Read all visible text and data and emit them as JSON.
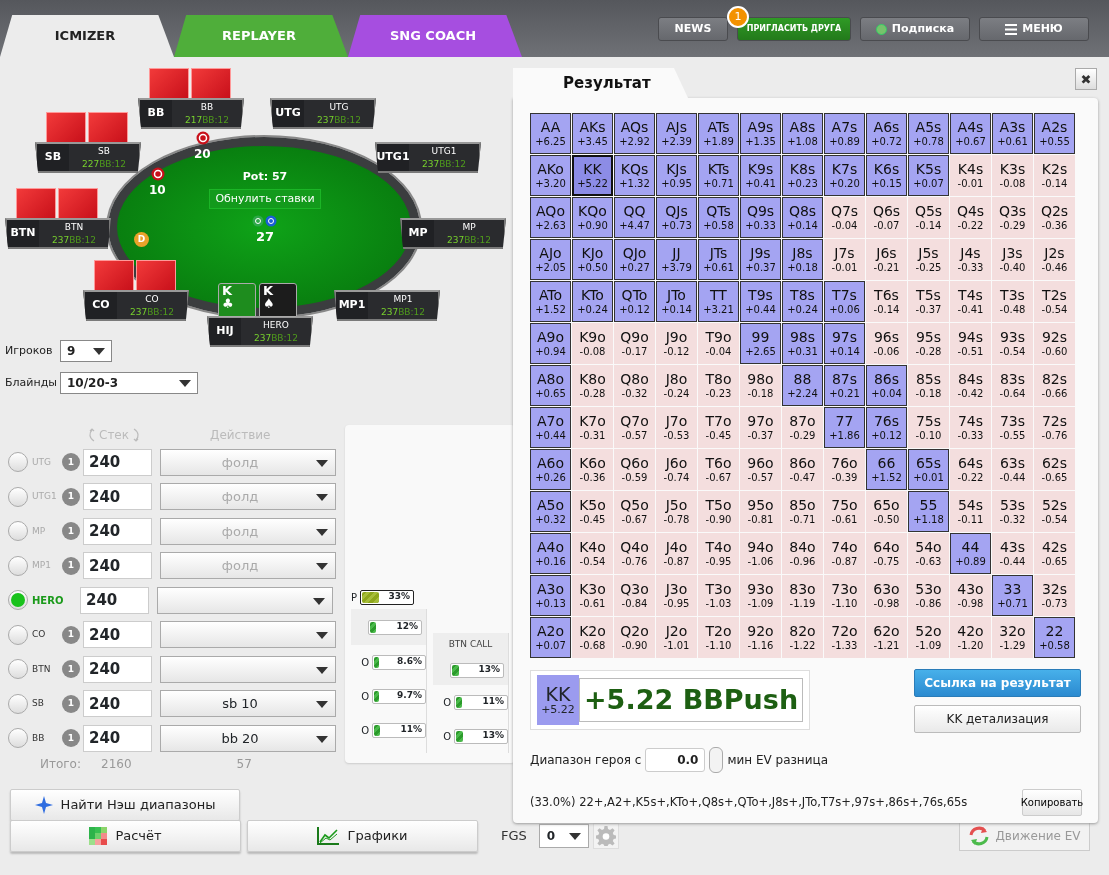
{
  "header": {
    "tabs": [
      {
        "label": "ICMIZER",
        "selected": true,
        "color": "#ececec"
      },
      {
        "label": "REPLAYER",
        "selected": false,
        "color": "#4fae3a"
      },
      {
        "label": "SNG COACH",
        "selected": false,
        "color": "#a64ee0"
      }
    ],
    "buttons": [
      {
        "kind": "plain",
        "label": "NEWS"
      },
      {
        "kind": "invite",
        "label": "ПРИГЛАСИТЬ ДРУГА",
        "badge": "1"
      },
      {
        "kind": "status",
        "label": "Подписка"
      },
      {
        "kind": "menu",
        "label": "МЕНЮ"
      }
    ]
  },
  "table": {
    "pot": "Pot: 57",
    "reset_button": "Обнулить ставки",
    "center_chips": "27",
    "dealer_button": "D",
    "seats": [
      {
        "position": "BB",
        "name": "BB",
        "stack": "217",
        "bb": "BB:12",
        "has_cards": true
      },
      {
        "position": "UTG",
        "name": "UTG",
        "stack": "237",
        "bb": "BB:12",
        "has_cards": false
      },
      {
        "position": "SB",
        "name": "SB",
        "stack": "227",
        "bb": "BB:12",
        "has_cards": true
      },
      {
        "position": "UTG1",
        "name": "UTG1",
        "stack": "237",
        "bb": "BB:12",
        "has_cards": false
      },
      {
        "position": "BTN",
        "name": "BTN",
        "stack": "237",
        "bb": "BB:12",
        "has_cards": true
      },
      {
        "position": "MP",
        "name": "MP",
        "stack": "237",
        "bb": "BB:12",
        "has_cards": false
      },
      {
        "position": "CO",
        "name": "CO",
        "stack": "237",
        "bb": "BB:12",
        "has_cards": true
      },
      {
        "position": "MP1",
        "name": "MP1",
        "stack": "237",
        "bb": "BB:12",
        "has_cards": false
      },
      {
        "position": "HIJ",
        "name": "HERO",
        "stack": "237",
        "bb": "BB:12",
        "has_cards": false
      }
    ],
    "hero_cards": [
      {
        "rank": "K",
        "suit": "♣",
        "color": "#1e8c1e"
      },
      {
        "rank": "K",
        "suit": "♠",
        "color": "#1c1c1c"
      }
    ],
    "bets": [
      {
        "amount": "20"
      },
      {
        "amount": "10"
      }
    ]
  },
  "settings": {
    "players": {
      "label": "Игроков",
      "value": "9"
    },
    "blinds": {
      "label": "Блайнды",
      "value": "10/20-3"
    }
  },
  "players_table": {
    "stack_header": "Стек",
    "action_header": "Действие",
    "rows": [
      {
        "position": "UTG",
        "selected": false,
        "folded": true,
        "count": "1",
        "stack": "240",
        "action": "фолд"
      },
      {
        "position": "UTG1",
        "selected": false,
        "folded": true,
        "count": "1",
        "stack": "240",
        "action": "фолд"
      },
      {
        "position": "MP",
        "selected": false,
        "folded": true,
        "count": "1",
        "stack": "240",
        "action": "фолд"
      },
      {
        "position": "MP1",
        "selected": false,
        "folded": true,
        "count": "1",
        "stack": "240",
        "action": "фолд"
      },
      {
        "position": "HERO",
        "selected": true,
        "folded": false,
        "stack": "240"
      },
      {
        "position": "CO",
        "selected": false,
        "folded": false,
        "count": "1",
        "stack": "240"
      },
      {
        "position": "BTN",
        "selected": false,
        "folded": false,
        "count": "1",
        "stack": "240"
      },
      {
        "position": "SB",
        "selected": false,
        "folded": false,
        "count": "1",
        "stack": "240",
        "action": "sb 10"
      },
      {
        "position": "BB",
        "selected": false,
        "folded": false,
        "count": "1",
        "stack": "240",
        "action": "bb 20"
      }
    ],
    "total_label": "Итого:",
    "total_stack": "2160",
    "total_pot": "57"
  },
  "ranges_panel": {
    "push": {
      "label": "P",
      "reading": "33%",
      "level": 0.33
    },
    "columns": [
      {
        "bars": [
          {
            "reading": "12%",
            "level": 0.12
          },
          {
            "label": "O",
            "reading": "8.6%",
            "level": 0.086
          },
          {
            "label": "O",
            "reading": "9.7%",
            "level": 0.097
          },
          {
            "label": "O",
            "reading": "11%",
            "level": 0.11
          }
        ]
      },
      {
        "header": "BTN CALL",
        "bars": [
          {
            "reading": "13%",
            "level": 0.13
          },
          {
            "label": "O",
            "reading": "11%",
            "level": 0.11
          },
          {
            "label": "O",
            "reading": "13%",
            "level": 0.13
          }
        ]
      }
    ]
  },
  "bottom": {
    "nash_button": "Найти Нэш диапазоны",
    "calc_button": "Расчёт",
    "charts_button": "Графики",
    "fgs_label": "FGS",
    "fgs_value": "0",
    "ev_button": {
      "label": "Движение EV",
      "disabled": true
    }
  },
  "result": {
    "tab": "Результат",
    "close": "✖",
    "matrix": [
      [
        {
          "hand": "AA",
          "ev": "+6.25",
          "in_range": true,
          "selected": false
        },
        {
          "hand": "AKs",
          "ev": "+3.45",
          "in_range": true,
          "selected": false
        },
        {
          "hand": "AQs",
          "ev": "+2.92",
          "in_range": true,
          "selected": false
        },
        {
          "hand": "AJs",
          "ev": "+2.39",
          "in_range": true,
          "selected": false
        },
        {
          "hand": "ATs",
          "ev": "+1.89",
          "in_range": true,
          "selected": false
        },
        {
          "hand": "A9s",
          "ev": "+1.35",
          "in_range": true,
          "selected": false
        },
        {
          "hand": "A8s",
          "ev": "+1.08",
          "in_range": true,
          "selected": false
        },
        {
          "hand": "A7s",
          "ev": "+0.89",
          "in_range": true,
          "selected": false
        },
        {
          "hand": "A6s",
          "ev": "+0.72",
          "in_range": true,
          "selected": false
        },
        {
          "hand": "A5s",
          "ev": "+0.78",
          "in_range": true,
          "selected": false
        },
        {
          "hand": "A4s",
          "ev": "+0.67",
          "in_range": true,
          "selected": false
        },
        {
          "hand": "A3s",
          "ev": "+0.61",
          "in_range": true,
          "selected": false
        },
        {
          "hand": "A2s",
          "ev": "+0.55",
          "in_range": true,
          "selected": false
        }
      ],
      [
        {
          "hand": "AKo",
          "ev": "+3.20",
          "in_range": true,
          "selected": false
        },
        {
          "hand": "KK",
          "ev": "+5.22",
          "in_range": true,
          "selected": true
        },
        {
          "hand": "KQs",
          "ev": "+1.32",
          "in_range": true,
          "selected": false
        },
        {
          "hand": "KJs",
          "ev": "+0.95",
          "in_range": true,
          "selected": false
        },
        {
          "hand": "KTs",
          "ev": "+0.71",
          "in_range": true,
          "selected": false
        },
        {
          "hand": "K9s",
          "ev": "+0.41",
          "in_range": true,
          "selected": false
        },
        {
          "hand": "K8s",
          "ev": "+0.23",
          "in_range": true,
          "selected": false
        },
        {
          "hand": "K7s",
          "ev": "+0.20",
          "in_range": true,
          "selected": false
        },
        {
          "hand": "K6s",
          "ev": "+0.15",
          "in_range": true,
          "selected": false
        },
        {
          "hand": "K5s",
          "ev": "+0.07",
          "in_range": true,
          "selected": false
        },
        {
          "hand": "K4s",
          "ev": "-0.01",
          "in_range": false,
          "selected": false
        },
        {
          "hand": "K3s",
          "ev": "-0.08",
          "in_range": false,
          "selected": false
        },
        {
          "hand": "K2s",
          "ev": "-0.14",
          "in_range": false,
          "selected": false
        }
      ],
      [
        {
          "hand": "AQo",
          "ev": "+2.63",
          "in_range": true,
          "selected": false
        },
        {
          "hand": "KQo",
          "ev": "+0.90",
          "in_range": true,
          "selected": false
        },
        {
          "hand": "QQ",
          "ev": "+4.47",
          "in_range": true,
          "selected": false
        },
        {
          "hand": "QJs",
          "ev": "+0.73",
          "in_range": true,
          "selected": false
        },
        {
          "hand": "QTs",
          "ev": "+0.58",
          "in_range": true,
          "selected": false
        },
        {
          "hand": "Q9s",
          "ev": "+0.33",
          "in_range": true,
          "selected": false
        },
        {
          "hand": "Q8s",
          "ev": "+0.14",
          "in_range": true,
          "selected": false
        },
        {
          "hand": "Q7s",
          "ev": "-0.04",
          "in_range": false,
          "selected": false
        },
        {
          "hand": "Q6s",
          "ev": "-0.07",
          "in_range": false,
          "selected": false
        },
        {
          "hand": "Q5s",
          "ev": "-0.14",
          "in_range": false,
          "selected": false
        },
        {
          "hand": "Q4s",
          "ev": "-0.22",
          "in_range": false,
          "selected": false
        },
        {
          "hand": "Q3s",
          "ev": "-0.29",
          "in_range": false,
          "selected": false
        },
        {
          "hand": "Q2s",
          "ev": "-0.36",
          "in_range": false,
          "selected": false
        }
      ],
      [
        {
          "hand": "AJo",
          "ev": "+2.05",
          "in_range": true,
          "selected": false
        },
        {
          "hand": "KJo",
          "ev": "+0.50",
          "in_range": true,
          "selected": false
        },
        {
          "hand": "QJo",
          "ev": "+0.27",
          "in_range": true,
          "selected": false
        },
        {
          "hand": "JJ",
          "ev": "+3.79",
          "in_range": true,
          "selected": false
        },
        {
          "hand": "JTs",
          "ev": "+0.61",
          "in_range": true,
          "selected": false
        },
        {
          "hand": "J9s",
          "ev": "+0.37",
          "in_range": true,
          "selected": false
        },
        {
          "hand": "J8s",
          "ev": "+0.18",
          "in_range": true,
          "selected": false
        },
        {
          "hand": "J7s",
          "ev": "-0.01",
          "in_range": false,
          "selected": false
        },
        {
          "hand": "J6s",
          "ev": "-0.21",
          "in_range": false,
          "selected": false
        },
        {
          "hand": "J5s",
          "ev": "-0.25",
          "in_range": false,
          "selected": false
        },
        {
          "hand": "J4s",
          "ev": "-0.33",
          "in_range": false,
          "selected": false
        },
        {
          "hand": "J3s",
          "ev": "-0.40",
          "in_range": false,
          "selected": false
        },
        {
          "hand": "J2s",
          "ev": "-0.46",
          "in_range": false,
          "selected": false
        }
      ],
      [
        {
          "hand": "ATo",
          "ev": "+1.52",
          "in_range": true,
          "selected": false
        },
        {
          "hand": "KTo",
          "ev": "+0.24",
          "in_range": true,
          "selected": false
        },
        {
          "hand": "QTo",
          "ev": "+0.12",
          "in_range": true,
          "selected": false
        },
        {
          "hand": "JTo",
          "ev": "+0.14",
          "in_range": true,
          "selected": false
        },
        {
          "hand": "TT",
          "ev": "+3.21",
          "in_range": true,
          "selected": false
        },
        {
          "hand": "T9s",
          "ev": "+0.44",
          "in_range": true,
          "selected": false
        },
        {
          "hand": "T8s",
          "ev": "+0.24",
          "in_range": true,
          "selected": false
        },
        {
          "hand": "T7s",
          "ev": "+0.06",
          "in_range": true,
          "selected": false
        },
        {
          "hand": "T6s",
          "ev": "-0.14",
          "in_range": false,
          "selected": false
        },
        {
          "hand": "T5s",
          "ev": "-0.37",
          "in_range": false,
          "selected": false
        },
        {
          "hand": "T4s",
          "ev": "-0.41",
          "in_range": false,
          "selected": false
        },
        {
          "hand": "T3s",
          "ev": "-0.48",
          "in_range": false,
          "selected": false
        },
        {
          "hand": "T2s",
          "ev": "-0.54",
          "in_range": false,
          "selected": false
        }
      ],
      [
        {
          "hand": "A9o",
          "ev": "+0.94",
          "in_range": true,
          "selected": false
        },
        {
          "hand": "K9o",
          "ev": "-0.08",
          "in_range": false,
          "selected": false
        },
        {
          "hand": "Q9o",
          "ev": "-0.17",
          "in_range": false,
          "selected": false
        },
        {
          "hand": "J9o",
          "ev": "-0.12",
          "in_range": false,
          "selected": false
        },
        {
          "hand": "T9o",
          "ev": "-0.04",
          "in_range": false,
          "selected": false
        },
        {
          "hand": "99",
          "ev": "+2.65",
          "in_range": true,
          "selected": false
        },
        {
          "hand": "98s",
          "ev": "+0.31",
          "in_range": true,
          "selected": false
        },
        {
          "hand": "97s",
          "ev": "+0.14",
          "in_range": true,
          "selected": false
        },
        {
          "hand": "96s",
          "ev": "-0.06",
          "in_range": false,
          "selected": false
        },
        {
          "hand": "95s",
          "ev": "-0.28",
          "in_range": false,
          "selected": false
        },
        {
          "hand": "94s",
          "ev": "-0.51",
          "in_range": false,
          "selected": false
        },
        {
          "hand": "93s",
          "ev": "-0.54",
          "in_range": false,
          "selected": false
        },
        {
          "hand": "92s",
          "ev": "-0.60",
          "in_range": false,
          "selected": false
        }
      ],
      [
        {
          "hand": "A8o",
          "ev": "+0.65",
          "in_range": true,
          "selected": false
        },
        {
          "hand": "K8o",
          "ev": "-0.28",
          "in_range": false,
          "selected": false
        },
        {
          "hand": "Q8o",
          "ev": "-0.32",
          "in_range": false,
          "selected": false
        },
        {
          "hand": "J8o",
          "ev": "-0.24",
          "in_range": false,
          "selected": false
        },
        {
          "hand": "T8o",
          "ev": "-0.23",
          "in_range": false,
          "selected": false
        },
        {
          "hand": "98o",
          "ev": "-0.18",
          "in_range": false,
          "selected": false
        },
        {
          "hand": "88",
          "ev": "+2.24",
          "in_range": true,
          "selected": false
        },
        {
          "hand": "87s",
          "ev": "+0.21",
          "in_range": true,
          "selected": false
        },
        {
          "hand": "86s",
          "ev": "+0.04",
          "in_range": true,
          "selected": false
        },
        {
          "hand": "85s",
          "ev": "-0.18",
          "in_range": false,
          "selected": false
        },
        {
          "hand": "84s",
          "ev": "-0.42",
          "in_range": false,
          "selected": false
        },
        {
          "hand": "83s",
          "ev": "-0.64",
          "in_range": false,
          "selected": false
        },
        {
          "hand": "82s",
          "ev": "-0.66",
          "in_range": false,
          "selected": false
        }
      ],
      [
        {
          "hand": "A7o",
          "ev": "+0.44",
          "in_range": true,
          "selected": false
        },
        {
          "hand": "K7o",
          "ev": "-0.31",
          "in_range": false,
          "selected": false
        },
        {
          "hand": "Q7o",
          "ev": "-0.57",
          "in_range": false,
          "selected": false
        },
        {
          "hand": "J7o",
          "ev": "-0.53",
          "in_range": false,
          "selected": false
        },
        {
          "hand": "T7o",
          "ev": "-0.45",
          "in_range": false,
          "selected": false
        },
        {
          "hand": "97o",
          "ev": "-0.37",
          "in_range": false,
          "selected": false
        },
        {
          "hand": "87o",
          "ev": "-0.29",
          "in_range": false,
          "selected": false
        },
        {
          "hand": "77",
          "ev": "+1.86",
          "in_range": true,
          "selected": false
        },
        {
          "hand": "76s",
          "ev": "+0.12",
          "in_range": true,
          "selected": false
        },
        {
          "hand": "75s",
          "ev": "-0.10",
          "in_range": false,
          "selected": false
        },
        {
          "hand": "74s",
          "ev": "-0.33",
          "in_range": false,
          "selected": false
        },
        {
          "hand": "73s",
          "ev": "-0.55",
          "in_range": false,
          "selected": false
        },
        {
          "hand": "72s",
          "ev": "-0.76",
          "in_range": false,
          "selected": false
        }
      ],
      [
        {
          "hand": "A6o",
          "ev": "+0.26",
          "in_range": true,
          "selected": false
        },
        {
          "hand": "K6o",
          "ev": "-0.36",
          "in_range": false,
          "selected": false
        },
        {
          "hand": "Q6o",
          "ev": "-0.59",
          "in_range": false,
          "selected": false
        },
        {
          "hand": "J6o",
          "ev": "-0.74",
          "in_range": false,
          "selected": false
        },
        {
          "hand": "T6o",
          "ev": "-0.67",
          "in_range": false,
          "selected": false
        },
        {
          "hand": "96o",
          "ev": "-0.57",
          "in_range": false,
          "selected": false
        },
        {
          "hand": "86o",
          "ev": "-0.47",
          "in_range": false,
          "selected": false
        },
        {
          "hand": "76o",
          "ev": "-0.39",
          "in_range": false,
          "selected": false
        },
        {
          "hand": "66",
          "ev": "+1.52",
          "in_range": true,
          "selected": false
        },
        {
          "hand": "65s",
          "ev": "+0.01",
          "in_range": true,
          "selected": false
        },
        {
          "hand": "64s",
          "ev": "-0.22",
          "in_range": false,
          "selected": false
        },
        {
          "hand": "63s",
          "ev": "-0.44",
          "in_range": false,
          "selected": false
        },
        {
          "hand": "62s",
          "ev": "-0.65",
          "in_range": false,
          "selected": false
        }
      ],
      [
        {
          "hand": "A5o",
          "ev": "+0.32",
          "in_range": true,
          "selected": false
        },
        {
          "hand": "K5o",
          "ev": "-0.45",
          "in_range": false,
          "selected": false
        },
        {
          "hand": "Q5o",
          "ev": "-0.67",
          "in_range": false,
          "selected": false
        },
        {
          "hand": "J5o",
          "ev": "-0.78",
          "in_range": false,
          "selected": false
        },
        {
          "hand": "T5o",
          "ev": "-0.90",
          "in_range": false,
          "selected": false
        },
        {
          "hand": "95o",
          "ev": "-0.81",
          "in_range": false,
          "selected": false
        },
        {
          "hand": "85o",
          "ev": "-0.71",
          "in_range": false,
          "selected": false
        },
        {
          "hand": "75o",
          "ev": "-0.61",
          "in_range": false,
          "selected": false
        },
        {
          "hand": "65o",
          "ev": "-0.50",
          "in_range": false,
          "selected": false
        },
        {
          "hand": "55",
          "ev": "+1.18",
          "in_range": true,
          "selected": false
        },
        {
          "hand": "54s",
          "ev": "-0.11",
          "in_range": false,
          "selected": false
        },
        {
          "hand": "53s",
          "ev": "-0.32",
          "in_range": false,
          "selected": false
        },
        {
          "hand": "52s",
          "ev": "-0.54",
          "in_range": false,
          "selected": false
        }
      ],
      [
        {
          "hand": "A4o",
          "ev": "+0.16",
          "in_range": true,
          "selected": false
        },
        {
          "hand": "K4o",
          "ev": "-0.54",
          "in_range": false,
          "selected": false
        },
        {
          "hand": "Q4o",
          "ev": "-0.76",
          "in_range": false,
          "selected": false
        },
        {
          "hand": "J4o",
          "ev": "-0.87",
          "in_range": false,
          "selected": false
        },
        {
          "hand": "T4o",
          "ev": "-0.95",
          "in_range": false,
          "selected": false
        },
        {
          "hand": "94o",
          "ev": "-1.06",
          "in_range": false,
          "selected": false
        },
        {
          "hand": "84o",
          "ev": "-0.96",
          "in_range": false,
          "selected": false
        },
        {
          "hand": "74o",
          "ev": "-0.87",
          "in_range": false,
          "selected": false
        },
        {
          "hand": "64o",
          "ev": "-0.75",
          "in_range": false,
          "selected": false
        },
        {
          "hand": "54o",
          "ev": "-0.63",
          "in_range": false,
          "selected": false
        },
        {
          "hand": "44",
          "ev": "+0.89",
          "in_range": true,
          "selected": false
        },
        {
          "hand": "43s",
          "ev": "-0.44",
          "in_range": false,
          "selected": false
        },
        {
          "hand": "42s",
          "ev": "-0.65",
          "in_range": false,
          "selected": false
        }
      ],
      [
        {
          "hand": "A3o",
          "ev": "+0.13",
          "in_range": true,
          "selected": false
        },
        {
          "hand": "K3o",
          "ev": "-0.61",
          "in_range": false,
          "selected": false
        },
        {
          "hand": "Q3o",
          "ev": "-0.84",
          "in_range": false,
          "selected": false
        },
        {
          "hand": "J3o",
          "ev": "-0.95",
          "in_range": false,
          "selected": false
        },
        {
          "hand": "T3o",
          "ev": "-1.03",
          "in_range": false,
          "selected": false
        },
        {
          "hand": "93o",
          "ev": "-1.09",
          "in_range": false,
          "selected": false
        },
        {
          "hand": "83o",
          "ev": "-1.19",
          "in_range": false,
          "selected": false
        },
        {
          "hand": "73o",
          "ev": "-1.10",
          "in_range": false,
          "selected": false
        },
        {
          "hand": "63o",
          "ev": "-0.98",
          "in_range": false,
          "selected": false
        },
        {
          "hand": "53o",
          "ev": "-0.86",
          "in_range": false,
          "selected": false
        },
        {
          "hand": "43o",
          "ev": "-0.98",
          "in_range": false,
          "selected": false
        },
        {
          "hand": "33",
          "ev": "+0.71",
          "in_range": true,
          "selected": false
        },
        {
          "hand": "32s",
          "ev": "-0.73",
          "in_range": false,
          "selected": false
        }
      ],
      [
        {
          "hand": "A2o",
          "ev": "+0.07",
          "in_range": true,
          "selected": false
        },
        {
          "hand": "K2o",
          "ev": "-0.68",
          "in_range": false,
          "selected": false
        },
        {
          "hand": "Q2o",
          "ev": "-0.90",
          "in_range": false,
          "selected": false
        },
        {
          "hand": "J2o",
          "ev": "-1.01",
          "in_range": false,
          "selected": false
        },
        {
          "hand": "T2o",
          "ev": "-1.10",
          "in_range": false,
          "selected": false
        },
        {
          "hand": "92o",
          "ev": "-1.16",
          "in_range": false,
          "selected": false
        },
        {
          "hand": "82o",
          "ev": "-1.22",
          "in_range": false,
          "selected": false
        },
        {
          "hand": "72o",
          "ev": "-1.33",
          "in_range": false,
          "selected": false
        },
        {
          "hand": "62o",
          "ev": "-1.21",
          "in_range": false,
          "selected": false
        },
        {
          "hand": "52o",
          "ev": "-1.09",
          "in_range": false,
          "selected": false
        },
        {
          "hand": "42o",
          "ev": "-1.20",
          "in_range": false,
          "selected": false
        },
        {
          "hand": "32o",
          "ev": "-1.29",
          "in_range": false,
          "selected": false
        },
        {
          "hand": "22",
          "ev": "+0.58",
          "in_range": true,
          "selected": false
        }
      ]
    ],
    "summary": {
      "hand": "KK",
      "ev": "+5.22",
      "text": "+5.22 BBPush"
    },
    "link_button": "Ссылка на результат",
    "detail_button": "KK детализация",
    "filter": {
      "label_before": "Диапазон героя с",
      "value": "0.0",
      "label_after": "мин EV разница"
    },
    "range_text": "(33.0%) 22+,A2+,K5s+,KTo+,Q8s+,QTo+,J8s+,JTo,T7s+,97s+,86s+,76s,65s",
    "copy_button": "Копировать"
  }
}
